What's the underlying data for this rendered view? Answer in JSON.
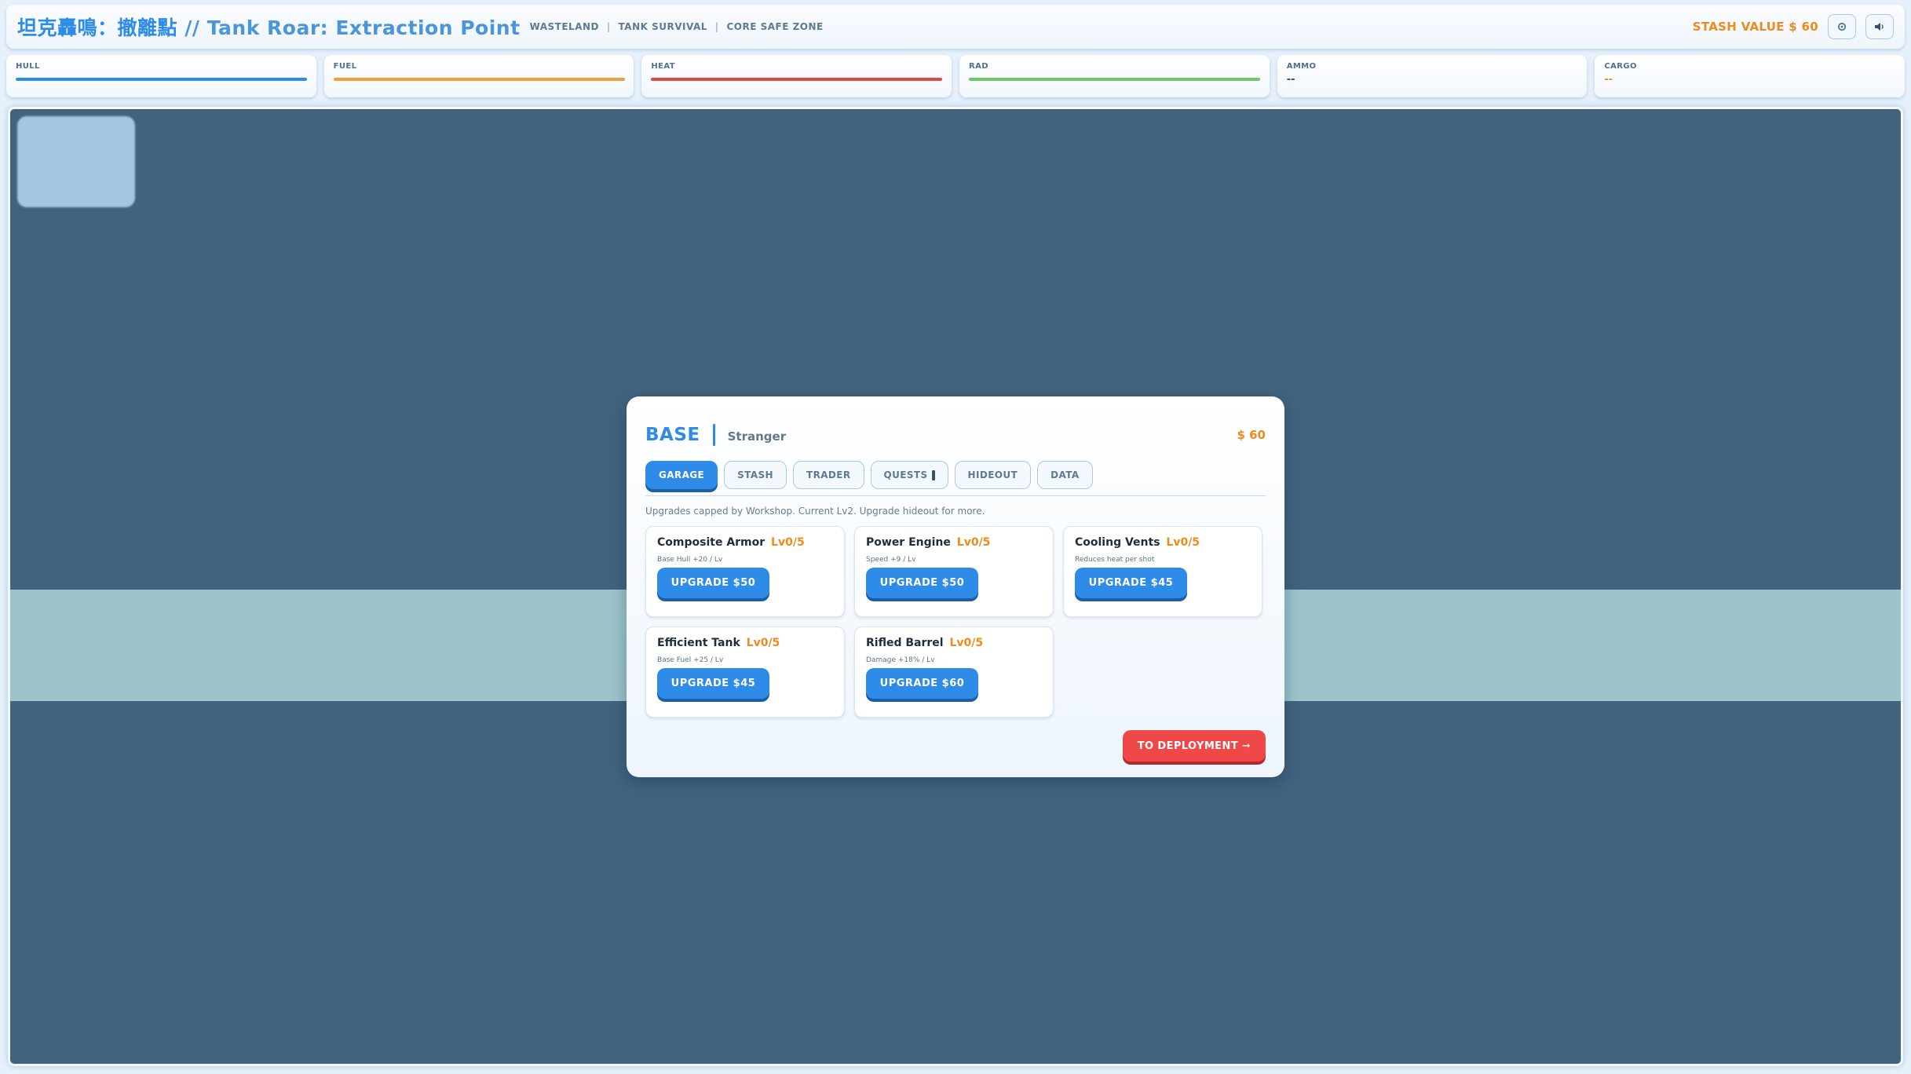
{
  "header": {
    "title": "坦克轟鳴：撤離點",
    "title_en": "// Tank Roar: Extraction Point",
    "breadcrumbs": [
      "WASTELAND",
      "TANK SURVIVAL",
      "CORE SAFE ZONE"
    ],
    "separator": "|",
    "stash_value": "STASH VALUE $ 60",
    "settings_icon": "gear-icon",
    "sound_icon": "speaker-icon"
  },
  "stats": {
    "hull": {
      "label": "HULL",
      "color": "#2e8ce8",
      "fill": 1.0
    },
    "fuel": {
      "label": "FUEL",
      "color": "#f0a040",
      "fill": 1.0
    },
    "heat": {
      "label": "HEAT",
      "color": "#e04848",
      "fill": 1.0
    },
    "rad": {
      "label": "RAD",
      "color": "#6cc864",
      "fill": 1.0
    },
    "ammo": {
      "label": "AMMO",
      "value": "--"
    },
    "cargo": {
      "label": "CARGO",
      "value": "--"
    }
  },
  "modal": {
    "title": "BASE",
    "player_name": "Stranger",
    "money": "$ 60",
    "tabs": [
      "GARAGE",
      "STASH",
      "TRADER",
      "QUESTS",
      "HIDEOUT",
      "DATA"
    ],
    "active_tab": "GARAGE",
    "notice": "Upgrades capped by Workshop. Current Lv2. Upgrade hideout for more.",
    "upgrades": [
      {
        "name": "Composite Armor",
        "level": "Lv0/5",
        "desc": "Base Hull +20 / Lv",
        "button": "UPGRADE $50"
      },
      {
        "name": "Power Engine",
        "level": "Lv0/5",
        "desc": "Speed +9 / Lv",
        "button": "UPGRADE $50"
      },
      {
        "name": "Cooling Vents",
        "level": "Lv0/5",
        "desc": "Reduces heat per shot",
        "button": "UPGRADE $45"
      },
      {
        "name": "Efficient Tank",
        "level": "Lv0/5",
        "desc": "Base Fuel +25 / Lv",
        "button": "UPGRADE $45"
      },
      {
        "name": "Rifled Barrel",
        "level": "Lv0/5",
        "desc": "Damage +18% / Lv",
        "button": "UPGRADE $60"
      }
    ],
    "deploy_button": "TO DEPLOYMENT ➞"
  }
}
